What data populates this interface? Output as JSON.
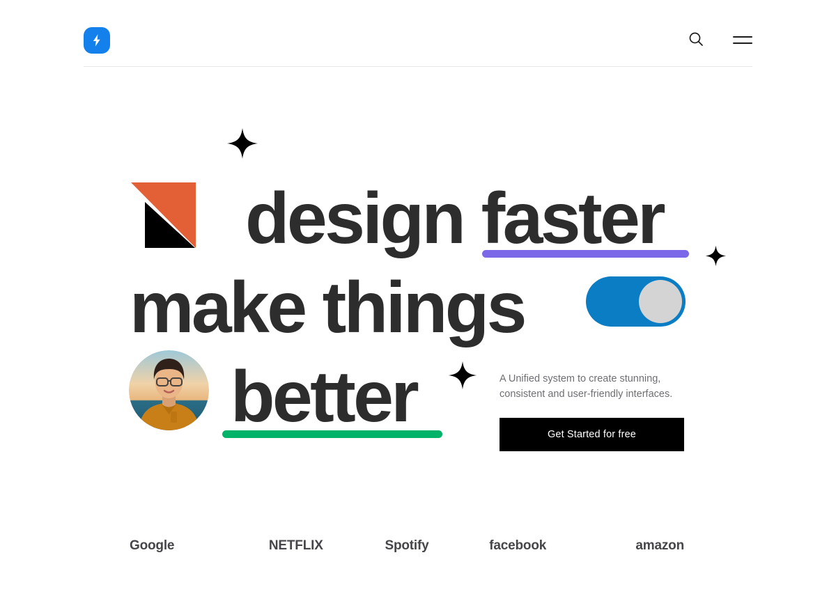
{
  "header": {
    "logo_name": "lightning-bolt-logo",
    "logo_color": "#1380ec",
    "search_label": "Search",
    "menu_label": "Menu"
  },
  "hero": {
    "headline_line_1": "design faster",
    "headline_line_2": "make things",
    "headline_line_3": "better",
    "headline_color": "#2d2d2d",
    "subtitle_line_1": "A Unified system to create stunning,",
    "subtitle_line_2": "consistent and user-friendly interfaces.",
    "cta_label": "Get Started for free",
    "cta_background": "#000000",
    "decor": {
      "triangle_color": "#e35f36",
      "square_color": "#000000",
      "underline_purple": "#7b68e8",
      "underline_green": "#00b368",
      "toggle_track": "#0b7dc4",
      "toggle_knob": "#d4d4d4",
      "toggle_state": "on",
      "avatar_alt": "Portrait of a young person with glasses in a mustard sweater"
    }
  },
  "brands": [
    {
      "name": "Google"
    },
    {
      "name": "NETFLIX"
    },
    {
      "name": "Spotify"
    },
    {
      "name": "facebook"
    },
    {
      "name": "amazon"
    }
  ]
}
